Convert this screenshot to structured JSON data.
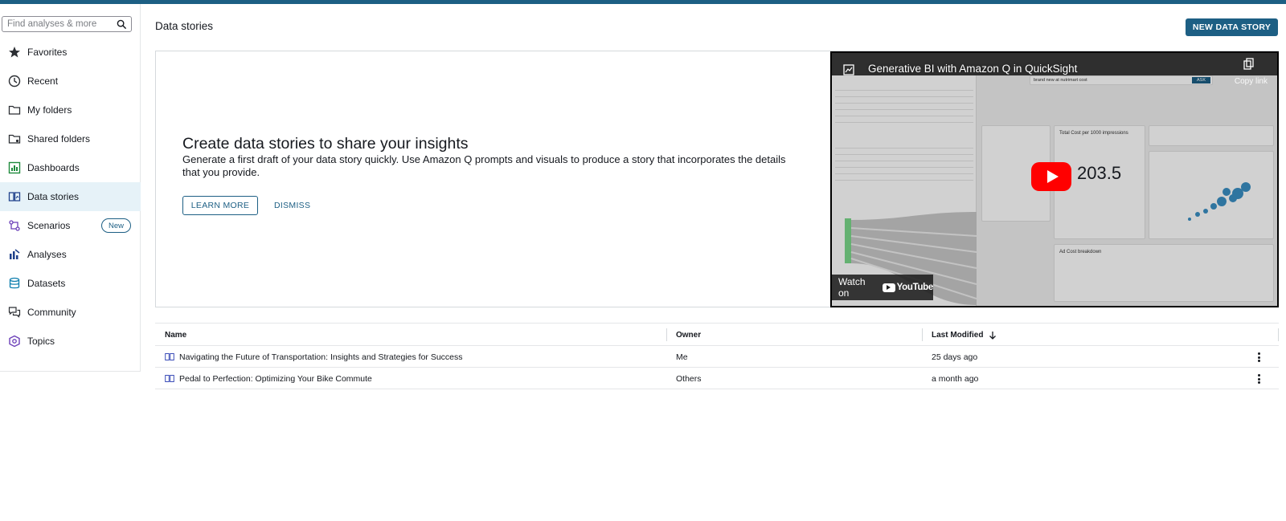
{
  "search": {
    "placeholder": "Find analyses & more"
  },
  "sidebar": {
    "items": [
      {
        "label": "Favorites",
        "icon": "star-icon"
      },
      {
        "label": "Recent",
        "icon": "clock-icon"
      },
      {
        "label": "My folders",
        "icon": "folder-icon"
      },
      {
        "label": "Shared folders",
        "icon": "shared-folder-icon"
      },
      {
        "label": "Dashboards",
        "icon": "dashboard-icon"
      },
      {
        "label": "Data stories",
        "icon": "data-story-icon",
        "active": true
      },
      {
        "label": "Scenarios",
        "icon": "scenarios-icon",
        "badge": "New"
      },
      {
        "label": "Analyses",
        "icon": "analyses-icon"
      },
      {
        "label": "Datasets",
        "icon": "datasets-icon"
      },
      {
        "label": "Community",
        "icon": "community-icon"
      },
      {
        "label": "Topics",
        "icon": "topics-icon"
      }
    ]
  },
  "header": {
    "title": "Data stories",
    "new_button": "NEW DATA STORY"
  },
  "banner": {
    "title": "Create data stories to share your insights",
    "description": "Generate a first draft of your data story quickly. Use Amazon Q prompts and visuals to produce a story that incorporates the details that you provide.",
    "learn_more": "LEARN MORE",
    "dismiss": "DISMISS",
    "video": {
      "title": "Generative BI with Amazon Q in QuickSight",
      "copy_link": "Copy link",
      "watch_on": "Watch on",
      "youtube": "YouTube",
      "big_value": "203.5",
      "ask_query": "brand new at nutrimart cost",
      "ask_button": "ASK",
      "card_total_cost": "Total Cost per 1000 impressions",
      "ad_cost_breakdown": "Ad Cost breakdown"
    }
  },
  "table": {
    "columns": [
      "Name",
      "Owner",
      "Last Modified"
    ],
    "rows": [
      {
        "name": "Navigating the Future of Transportation: Insights and Strategies for Success",
        "owner": "Me",
        "modified": "25 days ago"
      },
      {
        "name": "Pedal to Perfection: Optimizing Your Bike Commute",
        "owner": "Others",
        "modified": "a month ago"
      }
    ]
  },
  "colors": {
    "accent": "#1d5f84",
    "active_bg": "#e6f2f8",
    "play_red": "#ff0000"
  }
}
